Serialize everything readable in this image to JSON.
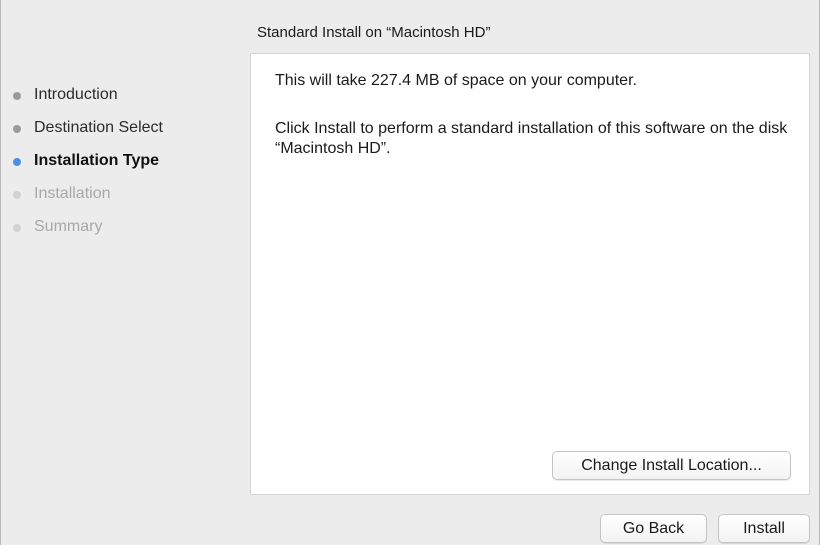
{
  "window": {
    "pane_title": "Standard Install on “Macintosh HD”"
  },
  "sidebar": {
    "steps": [
      {
        "label": "Introduction",
        "state": "done"
      },
      {
        "label": "Destination Select",
        "state": "done"
      },
      {
        "label": "Installation Type",
        "state": "current"
      },
      {
        "label": "Installation",
        "state": "pending"
      },
      {
        "label": "Summary",
        "state": "pending"
      }
    ]
  },
  "content": {
    "space_message": "This will take 227.4 MB of space on your computer.",
    "install_message": "Click Install to perform a standard installation of this software on the disk “Macintosh HD”.",
    "change_location_label": "Change Install Location..."
  },
  "footer": {
    "back_label": "Go Back",
    "install_label": "Install"
  },
  "colors": {
    "current_step_dot": "#4a90e2",
    "done_step_dot": "#9a9a9a",
    "pending_step_dot": "#d2d2d2",
    "window_background": "#ececec",
    "content_background": "#ffffff"
  }
}
